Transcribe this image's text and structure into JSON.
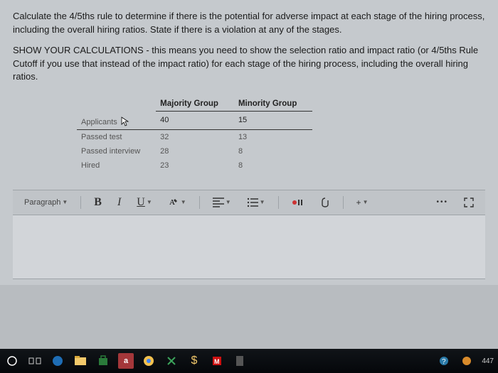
{
  "question": {
    "p1": "Calculate the 4/5ths rule to determine if there is the potential for adverse impact at each stage of the hiring process, including the overall hiring ratios. State if there is a violation at any of the stages.",
    "p2": "SHOW YOUR CALCULATIONS - this means you need to show the selection ratio and impact ratio (or 4/5ths Rule Cutoff if you use that instead of the impact ratio) for each stage of the hiring process, including the overall hiring ratios."
  },
  "table": {
    "headers": {
      "col1": "",
      "col2": "Majority Group",
      "col3": "Minority Group"
    },
    "rows": [
      {
        "label": "Applicants",
        "majority": "40",
        "minority": "15"
      },
      {
        "label": "Passed test",
        "majority": "32",
        "minority": "13"
      },
      {
        "label": "Passed interview",
        "majority": "28",
        "minority": "8"
      },
      {
        "label": "Hired",
        "majority": "23",
        "minority": "8"
      }
    ]
  },
  "toolbar": {
    "paragraph": "Paragraph",
    "bold": "B",
    "italic": "I",
    "underline": "U",
    "plus": "+",
    "more": "•••"
  },
  "taskbar": {
    "word_count": "447"
  }
}
